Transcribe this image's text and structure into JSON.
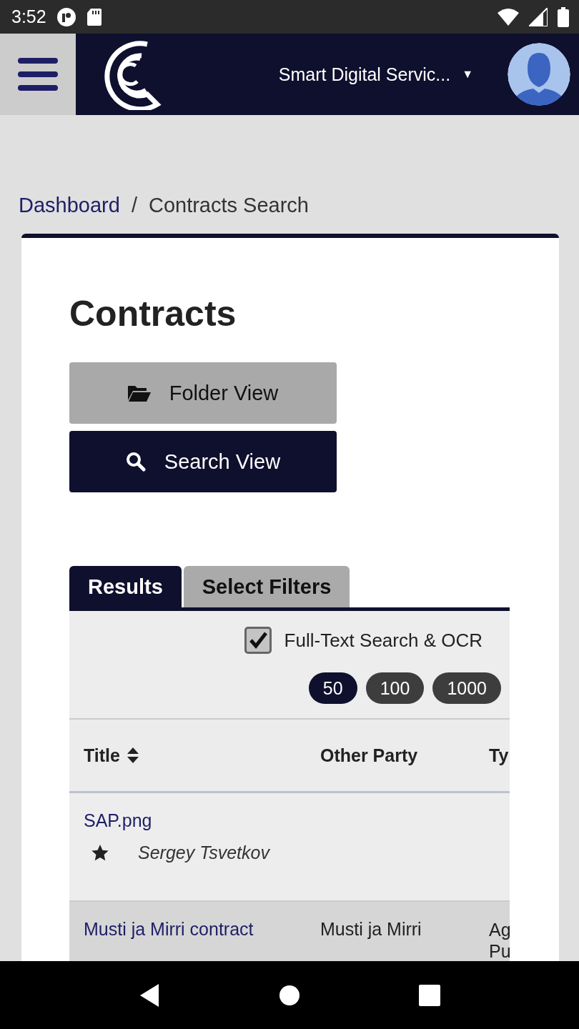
{
  "status_bar": {
    "time": "3:52"
  },
  "header": {
    "workspace": "Smart Digital Servic...",
    "dropdown_icon": "▼"
  },
  "breadcrumb": [
    {
      "label": "Dashboard",
      "kind": "link"
    },
    {
      "label": "/",
      "kind": "separator"
    },
    {
      "label": "Contracts Search",
      "kind": "current"
    }
  ],
  "page": {
    "title": "Contracts"
  },
  "view_buttons": [
    {
      "label": "Folder View",
      "kind": "folder",
      "selected": false
    },
    {
      "label": "Search View",
      "kind": "search",
      "selected": true
    }
  ],
  "tabs": [
    {
      "label": "Results",
      "selected": true
    },
    {
      "label": "Select Filters",
      "selected": false
    }
  ],
  "full_text_search": {
    "label": "Full-Text Search & OCR",
    "checked": true
  },
  "page_sizes": [
    {
      "label": "50",
      "selected": true
    },
    {
      "label": "100",
      "selected": false
    },
    {
      "label": "1000",
      "selected": false
    }
  ],
  "table": {
    "columns": [
      {
        "label": "Title",
        "sortable": true
      },
      {
        "label": "Other Party"
      },
      {
        "label": "Ty"
      }
    ],
    "rows": [
      {
        "title": "SAP.png",
        "owner": "Sergey Tsvetkov",
        "starred": true
      },
      {
        "title": "Musti ja Mirri contract",
        "other_party": "Musti ja Mirri",
        "type": [
          "Ag",
          "Pu"
        ]
      }
    ]
  }
}
